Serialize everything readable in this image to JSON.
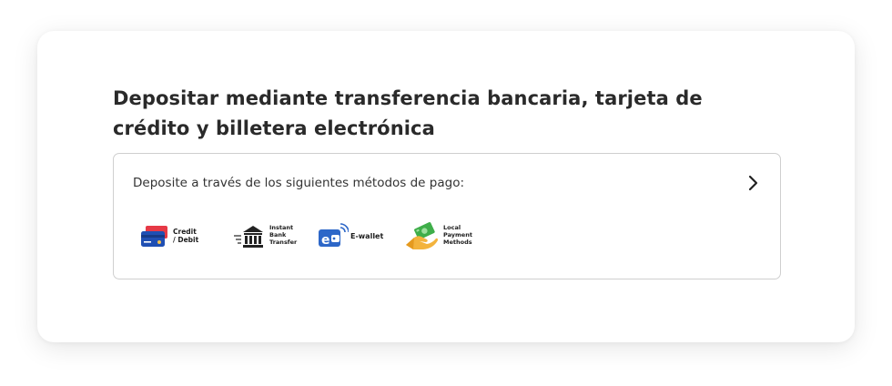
{
  "deposit_section": {
    "title": "Depositar mediante transferencia bancaria, tarjeta de crédito y billetera electrónica",
    "subtitle": "Deposite a través de los siguientes métodos de pago:",
    "chevron_icon": "chevron-right-icon",
    "payment_methods": [
      {
        "label": "Credit\n/ Debit",
        "icon": "credit-card-icon",
        "colors": [
          "#e63946",
          "#1f4fb3"
        ]
      },
      {
        "label": "Instant\nBank\nTransfer",
        "icon": "bank-icon",
        "colors": [
          "#222222"
        ]
      },
      {
        "label": "E-wallet",
        "icon": "e-wallet-icon",
        "colors": [
          "#2d67c8"
        ]
      },
      {
        "label": "Local\nPayment\nMethods",
        "icon": "hand-money-icon",
        "colors": [
          "#f3b33d",
          "#3fae4a"
        ]
      }
    ]
  }
}
